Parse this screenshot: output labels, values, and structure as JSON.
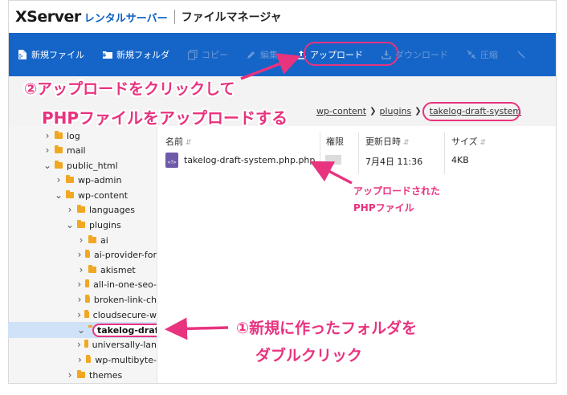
{
  "brand": {
    "logo_main": "XServer",
    "logo_sub": "レンタルサーバー",
    "app_title": "ファイルマネージャ"
  },
  "toolbar": {
    "new_file": "新規ファイル",
    "new_folder": "新規フォルダ",
    "copy": "コピー",
    "edit": "編集",
    "upload": "アップロード",
    "download": "ダウンロード",
    "compress": "圧縮"
  },
  "breadcrumb": [
    "wp-content",
    "plugins",
    "takelog-draft-system"
  ],
  "tree": {
    "items": [
      {
        "label": "log"
      },
      {
        "label": "mail"
      },
      {
        "label": "public_html"
      },
      {
        "label": "wp-admin"
      },
      {
        "label": "wp-content"
      },
      {
        "label": "languages"
      },
      {
        "label": "plugins"
      },
      {
        "label": "ai"
      },
      {
        "label": "ai-provider-for"
      },
      {
        "label": "akismet"
      },
      {
        "label": "all-in-one-seo-"
      },
      {
        "label": "broken-link-ch"
      },
      {
        "label": "cloudsecure-w"
      },
      {
        "label": "takelog-draft"
      },
      {
        "label": "universally-lan"
      },
      {
        "label": "wp-multibyte-"
      },
      {
        "label": "themes"
      }
    ]
  },
  "file_list": {
    "columns": {
      "name": "名前",
      "perm": "権限",
      "date": "更新日時",
      "size": "サイズ"
    },
    "rows": [
      {
        "name": "takelog-draft-system.php.php",
        "date": "7月4日 11:36",
        "size": "4KB"
      }
    ]
  },
  "annotations": {
    "step2_line1": "②アップロードをクリックして",
    "step2_line2": "PHPファイルをアップロードする",
    "uploaded_line1": "アップロードされた",
    "uploaded_line2": "PHPファイル",
    "step1_line1": "①新規に作ったフォルダを",
    "step1_line2": "ダブルクリック"
  },
  "colors": {
    "toolbar_bg": "#1565c8",
    "annotation": "#e8337f",
    "folder": "#f0a823",
    "selected_row": "#cfe2f7"
  }
}
